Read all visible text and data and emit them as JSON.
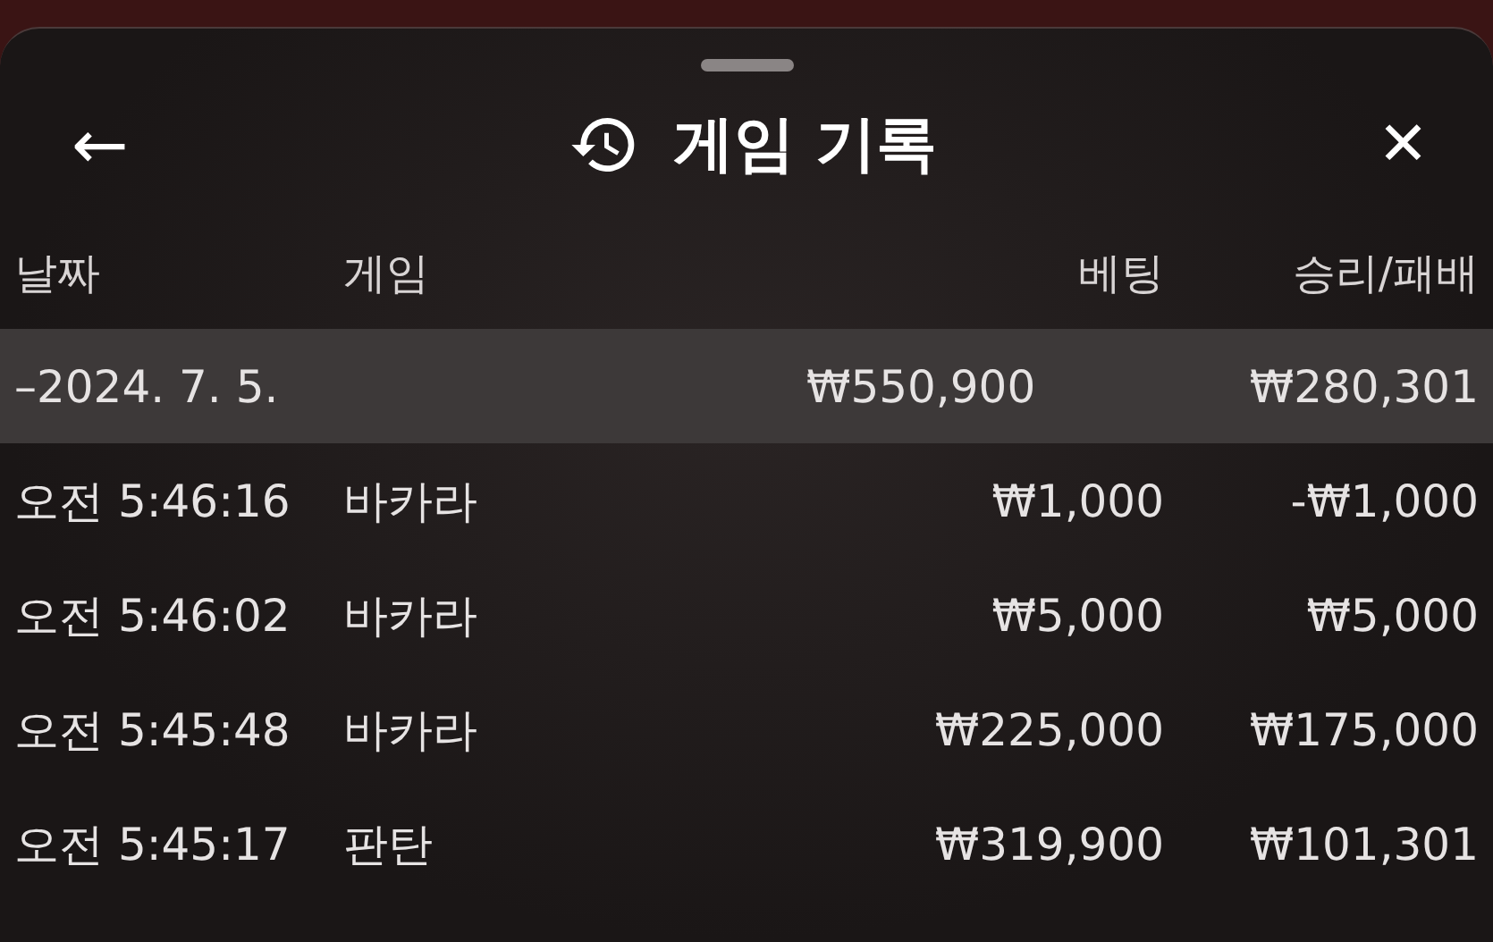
{
  "header": {
    "title": "게임 기록",
    "back": "←",
    "close": "✕"
  },
  "columns": [
    "날짜",
    "게임",
    "베팅",
    "승리/패배"
  ],
  "group": {
    "date": "–2024. 7. 5.",
    "bet": "₩550,900",
    "result": "₩280,301",
    "selected": true
  },
  "rows": [
    {
      "time": "오전 5:46:16",
      "game": "바카라",
      "bet": "₩1,000",
      "result": "-₩1,000"
    },
    {
      "time": "오전 5:46:02",
      "game": "바카라",
      "bet": "₩5,000",
      "result": "₩5,000"
    },
    {
      "time": "오전 5:45:48",
      "game": "바카라",
      "bet": "₩225,000",
      "result": "₩175,000"
    },
    {
      "time": "오전 5:45:17",
      "game": "판탄",
      "bet": "₩319,900",
      "result": "₩101,301"
    }
  ]
}
